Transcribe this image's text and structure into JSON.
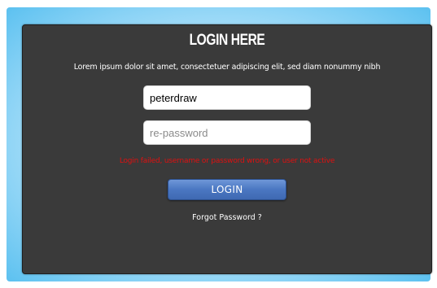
{
  "login": {
    "title": "LOGIN HERE",
    "description": "Lorem ipsum dolor sit amet, consectetuer adipiscing elit, sed diam nonummy nibh",
    "username_value": "peterdraw",
    "password_placeholder": "re-password",
    "error_message": "Login failed, username or password wrong, or user not active",
    "login_button_label": "LOGIN",
    "forgot_link": "Forgot Password ?"
  },
  "colors": {
    "panel_background": "#3a3a3a",
    "frame_glow": "#5cc1f0",
    "error_text": "#e01010",
    "button_blue": "#4a77c2"
  }
}
